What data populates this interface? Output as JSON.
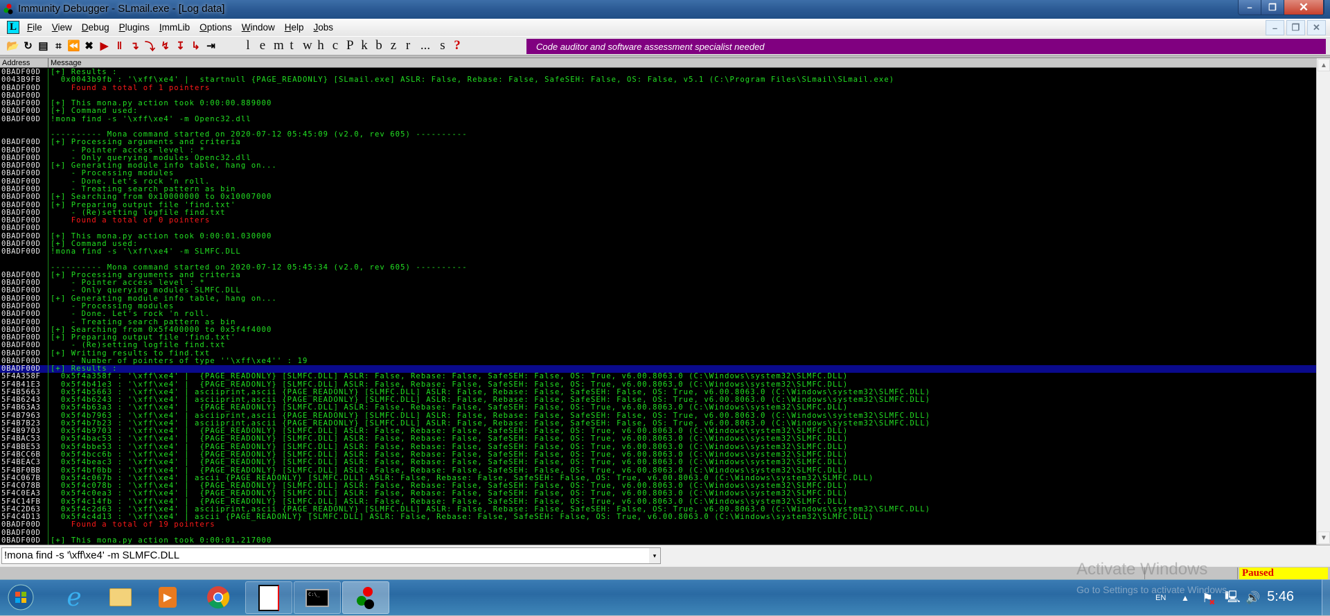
{
  "window": {
    "title": "Immunity Debugger - SLmail.exe - [Log data]",
    "minimize": "–",
    "maximize": "❐",
    "close": "✕"
  },
  "menu": {
    "app_icon": "L",
    "items": [
      "File",
      "View",
      "Debug",
      "Plugins",
      "ImmLib",
      "Options",
      "Window",
      "Help",
      "Jobs"
    ]
  },
  "toolbar": {
    "icons": [
      {
        "name": "open-folder-icon",
        "glyph": "📂",
        "dark": true
      },
      {
        "name": "restart-icon",
        "glyph": "↻",
        "dark": true
      },
      {
        "name": "close-file-icon",
        "glyph": "▤",
        "dark": true
      },
      {
        "name": "python-script-icon",
        "glyph": "⌗",
        "dark": true
      },
      {
        "name": "rewind-icon",
        "glyph": "⏪",
        "dark": true
      },
      {
        "name": "terminate-icon",
        "glyph": "✖",
        "dark": true
      },
      {
        "name": "run-icon",
        "glyph": "▶",
        "dark": false
      },
      {
        "name": "pause-icon",
        "glyph": "‖",
        "dark": false
      },
      {
        "name": "step-into-icon",
        "glyph": "↴",
        "dark": false
      },
      {
        "name": "step-over-icon",
        "glyph": "⤵",
        "dark": false
      },
      {
        "name": "trace-into-icon",
        "glyph": "↯",
        "dark": false
      },
      {
        "name": "trace-over-icon",
        "glyph": "↧",
        "dark": false
      },
      {
        "name": "execute-till-return-icon",
        "glyph": "↳",
        "dark": false
      },
      {
        "name": "go-to-icon",
        "glyph": "⇥",
        "dark": true
      }
    ],
    "letters": [
      "l",
      "e",
      "m",
      "t",
      "w",
      "h",
      "c",
      "P",
      "k",
      "b",
      "z",
      "r",
      "...",
      "s",
      "?"
    ],
    "banner": "Code auditor and software assessment specialist needed"
  },
  "log": {
    "headers": [
      "Address",
      "Message"
    ],
    "rows": [
      {
        "a": "0BADF00D",
        "m": "[+] Results :"
      },
      {
        "a": "0043B9FB",
        "m": "  0x0043b9fb : '\\xff\\xe4' |  startnull {PAGE_READONLY} [SLmail.exe] ASLR: False, Rebase: False, SafeSEH: False, OS: False, v5.1 (C:\\Program Files\\SLmail\\SLmail.exe)"
      },
      {
        "a": "0BADF00D",
        "m": "    Found a total of 1 pointers",
        "red": true
      },
      {
        "a": "0BADF00D",
        "m": ""
      },
      {
        "a": "0BADF00D",
        "m": "[+] This mona.py action took 0:00:00.889000"
      },
      {
        "a": "0BADF00D",
        "m": "[+] Command used:"
      },
      {
        "a": "0BADF00D",
        "m": "!mona find -s '\\xff\\xe4' -m Openc32.dll"
      },
      {
        "a": "",
        "m": ""
      },
      {
        "a": "",
        "m": "---------- Mona command started on 2020-07-12 05:45:09 (v2.0, rev 605) ----------"
      },
      {
        "a": "0BADF00D",
        "m": "[+] Processing arguments and criteria"
      },
      {
        "a": "0BADF00D",
        "m": "    - Pointer access level : *"
      },
      {
        "a": "0BADF00D",
        "m": "    - Only querying modules Openc32.dll"
      },
      {
        "a": "0BADF00D",
        "m": "[+] Generating module info table, hang on..."
      },
      {
        "a": "0BADF00D",
        "m": "    - Processing modules"
      },
      {
        "a": "0BADF00D",
        "m": "    - Done. Let's rock 'n roll."
      },
      {
        "a": "0BADF00D",
        "m": "    - Treating search pattern as bin"
      },
      {
        "a": "0BADF00D",
        "m": "[+] Searching from 0x10000000 to 0x10007000"
      },
      {
        "a": "0BADF00D",
        "m": "[+] Preparing output file 'find.txt'"
      },
      {
        "a": "0BADF00D",
        "m": "    - (Re)setting logfile find.txt"
      },
      {
        "a": "0BADF00D",
        "m": "    Found a total of 0 pointers",
        "red": true
      },
      {
        "a": "0BADF00D",
        "m": ""
      },
      {
        "a": "0BADF00D",
        "m": "[+] This mona.py action took 0:00:01.030000"
      },
      {
        "a": "0BADF00D",
        "m": "[+] Command used:"
      },
      {
        "a": "0BADF00D",
        "m": "!mona find -s '\\xff\\xe4' -m SLMFC.DLL"
      },
      {
        "a": "",
        "m": ""
      },
      {
        "a": "",
        "m": "---------- Mona command started on 2020-07-12 05:45:34 (v2.0, rev 605) ----------"
      },
      {
        "a": "0BADF00D",
        "m": "[+] Processing arguments and criteria"
      },
      {
        "a": "0BADF00D",
        "m": "    - Pointer access level : *"
      },
      {
        "a": "0BADF00D",
        "m": "    - Only querying modules SLMFC.DLL"
      },
      {
        "a": "0BADF00D",
        "m": "[+] Generating module info table, hang on..."
      },
      {
        "a": "0BADF00D",
        "m": "    - Processing modules"
      },
      {
        "a": "0BADF00D",
        "m": "    - Done. Let's rock 'n roll."
      },
      {
        "a": "0BADF00D",
        "m": "    - Treating search pattern as bin"
      },
      {
        "a": "0BADF00D",
        "m": "[+] Searching from 0x5f400000 to 0x5f4f4000"
      },
      {
        "a": "0BADF00D",
        "m": "[+] Preparing output file 'find.txt'"
      },
      {
        "a": "0BADF00D",
        "m": "    - (Re)setting logfile find.txt"
      },
      {
        "a": "0BADF00D",
        "m": "[+] Writing results to find.txt"
      },
      {
        "a": "0BADF00D",
        "m": "    - Number of pointers of type ''\\xff\\xe4'' : 19"
      },
      {
        "a": "0BADF00D",
        "m": "[+] Results :",
        "selected": true
      },
      {
        "a": "5F4A358F",
        "m": "  0x5f4a358f : '\\xff\\xe4' |  {PAGE_READONLY} [SLMFC.DLL] ASLR: False, Rebase: False, SafeSEH: False, OS: True, v6.00.8063.0 (C:\\Windows\\system32\\SLMFC.DLL)"
      },
      {
        "a": "5F4B41E3",
        "m": "  0x5f4b41e3 : '\\xff\\xe4' |  {PAGE_READONLY} [SLMFC.DLL] ASLR: False, Rebase: False, SafeSEH: False, OS: True, v6.00.8063.0 (C:\\Windows\\system32\\SLMFC.DLL)"
      },
      {
        "a": "5F4B5663",
        "m": "  0x5f4b5663 : '\\xff\\xe4' | asciiprint,ascii {PAGE_READONLY} [SLMFC.DLL] ASLR: False, Rebase: False, SafeSEH: False, OS: True, v6.00.8063.0 (C:\\Windows\\system32\\SLMFC.DLL)"
      },
      {
        "a": "5F4B6243",
        "m": "  0x5f4b6243 : '\\xff\\xe4' | asciiprint,ascii {PAGE_READONLY} [SLMFC.DLL] ASLR: False, Rebase: False, SafeSEH: False, OS: True, v6.00.8063.0 (C:\\Windows\\system32\\SLMFC.DLL)"
      },
      {
        "a": "5F4B63A3",
        "m": "  0x5f4b63a3 : '\\xff\\xe4' |  {PAGE_READONLY} [SLMFC.DLL] ASLR: False, Rebase: False, SafeSEH: False, OS: True, v6.00.8063.0 (C:\\Windows\\system32\\SLMFC.DLL)"
      },
      {
        "a": "5F4B7963",
        "m": "  0x5f4b7963 : '\\xff\\xe4' | asciiprint,ascii {PAGE_READONLY} [SLMFC.DLL] ASLR: False, Rebase: False, SafeSEH: False, OS: True, v6.00.8063.0 (C:\\Windows\\system32\\SLMFC.DLL)"
      },
      {
        "a": "5F4B7B23",
        "m": "  0x5f4b7b23 : '\\xff\\xe4' | asciiprint,ascii {PAGE_READONLY} [SLMFC.DLL] ASLR: False, Rebase: False, SafeSEH: False, OS: True, v6.00.8063.0 (C:\\Windows\\system32\\SLMFC.DLL)"
      },
      {
        "a": "5F4B9703",
        "m": "  0x5f4b9703 : '\\xff\\xe4' |  {PAGE_READONLY} [SLMFC.DLL] ASLR: False, Rebase: False, SafeSEH: False, OS: True, v6.00.8063.0 (C:\\Windows\\system32\\SLMFC.DLL)"
      },
      {
        "a": "5F4BAC53",
        "m": "  0x5f4bac53 : '\\xff\\xe4' |  {PAGE_READONLY} [SLMFC.DLL] ASLR: False, Rebase: False, SafeSEH: False, OS: True, v6.00.8063.0 (C:\\Windows\\system32\\SLMFC.DLL)"
      },
      {
        "a": "5F4BBE53",
        "m": "  0x5f4bbe53 : '\\xff\\xe4' |  {PAGE_READONLY} [SLMFC.DLL] ASLR: False, Rebase: False, SafeSEH: False, OS: True, v6.00.8063.0 (C:\\Windows\\system32\\SLMFC.DLL)"
      },
      {
        "a": "5F4BCC6B",
        "m": "  0x5f4bcc6b : '\\xff\\xe4' |  {PAGE_READONLY} [SLMFC.DLL] ASLR: False, Rebase: False, SafeSEH: False, OS: True, v6.00.8063.0 (C:\\Windows\\system32\\SLMFC.DLL)"
      },
      {
        "a": "5F4BEAC3",
        "m": "  0x5f4beac3 : '\\xff\\xe4' |  {PAGE_READONLY} [SLMFC.DLL] ASLR: False, Rebase: False, SafeSEH: False, OS: True, v6.00.8063.0 (C:\\Windows\\system32\\SLMFC.DLL)"
      },
      {
        "a": "5F4BF0BB",
        "m": "  0x5f4bf0bb : '\\xff\\xe4' |  {PAGE_READONLY} [SLMFC.DLL] ASLR: False, Rebase: False, SafeSEH: False, OS: True, v6.00.8063.0 (C:\\Windows\\system32\\SLMFC.DLL)"
      },
      {
        "a": "5F4C067B",
        "m": "  0x5f4c067b : '\\xff\\xe4' | ascii {PAGE_READONLY} [SLMFC.DLL] ASLR: False, Rebase: False, SafeSEH: False, OS: True, v6.00.8063.0 (C:\\Windows\\system32\\SLMFC.DLL)"
      },
      {
        "a": "5F4C078B",
        "m": "  0x5f4c078b : '\\xff\\xe4' |  {PAGE_READONLY} [SLMFC.DLL] ASLR: False, Rebase: False, SafeSEH: False, OS: True, v6.00.8063.0 (C:\\Windows\\system32\\SLMFC.DLL)"
      },
      {
        "a": "5F4C0EA3",
        "m": "  0x5f4c0ea3 : '\\xff\\xe4' |  {PAGE_READONLY} [SLMFC.DLL] ASLR: False, Rebase: False, SafeSEH: False, OS: True, v6.00.8063.0 (C:\\Windows\\system32\\SLMFC.DLL)"
      },
      {
        "a": "5F4C14FB",
        "m": "  0x5f4c14fb : '\\xff\\xe4' |  {PAGE_READONLY} [SLMFC.DLL] ASLR: False, Rebase: False, SafeSEH: False, OS: True, v6.00.8063.0 (C:\\Windows\\system32\\SLMFC.DLL)"
      },
      {
        "a": "5F4C2D63",
        "m": "  0x5f4c2d63 : '\\xff\\xe4' | asciiprint,ascii {PAGE_READONLY} [SLMFC.DLL] ASLR: False, Rebase: False, SafeSEH: False, OS: True, v6.00.8063.0 (C:\\Windows\\system32\\SLMFC.DLL)"
      },
      {
        "a": "5F4C4D13",
        "m": "  0x5f4c4d13 : '\\xff\\xe4' | ascii {PAGE_READONLY} [SLMFC.DLL] ASLR: False, Rebase: False, SafeSEH: False, OS: True, v6.00.8063.0 (C:\\Windows\\system32\\SLMFC.DLL)"
      },
      {
        "a": "0BADF00D",
        "m": "    Found a total of 19 pointers",
        "red": true
      },
      {
        "a": "0BADF00D",
        "m": ""
      },
      {
        "a": "0BADF00D",
        "m": "[+] This mona.py action took 0:00:01.217000"
      }
    ]
  },
  "command": {
    "value": "!mona find -s '\\xff\\xe4' -m SLMFC.DLL",
    "dropdown": "▾"
  },
  "status": {
    "state": "Paused"
  },
  "watermark": {
    "line1": "Activate Windows",
    "line2": "Go to Settings to activate Windows."
  },
  "taskbar": {
    "language": "EN",
    "clock": "5:46"
  },
  "colors": {
    "log_text": "#22e022",
    "error_text": "#ff1a1a",
    "selection": "#0a0a8c",
    "banner": "#800080",
    "paused_bg": "#ffff00"
  }
}
